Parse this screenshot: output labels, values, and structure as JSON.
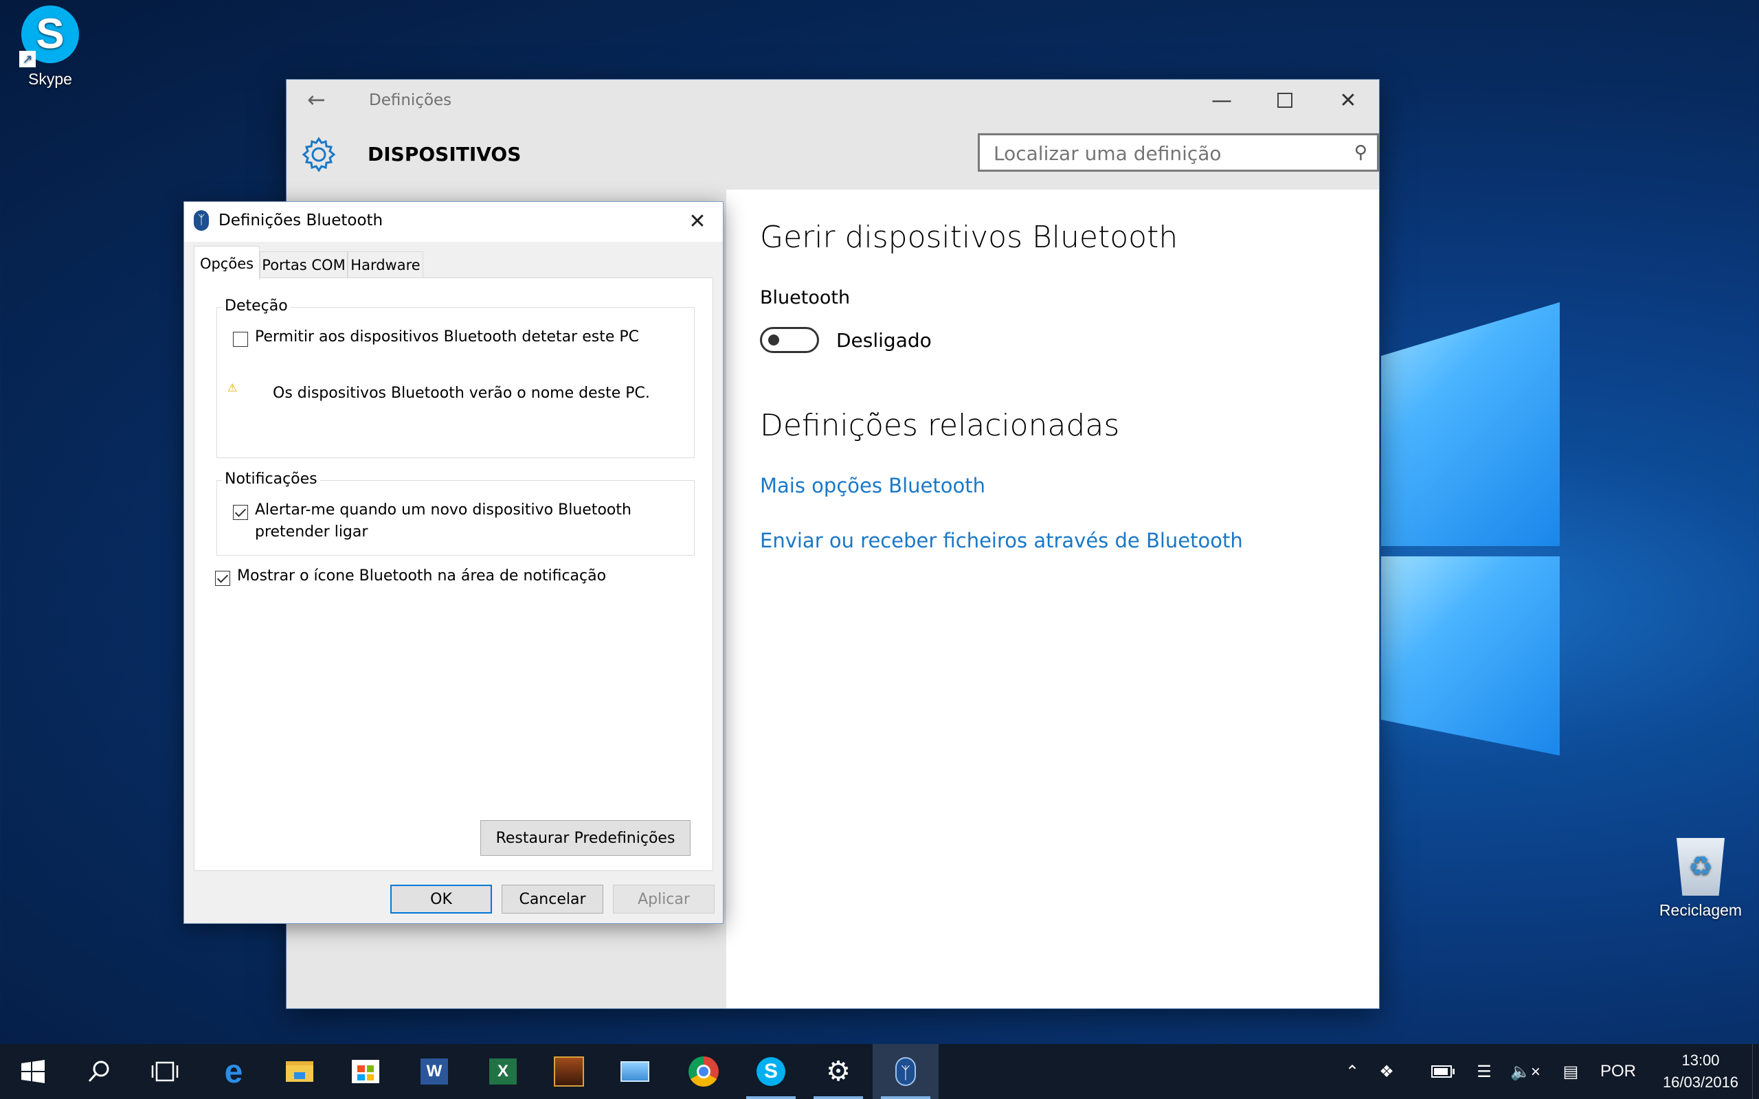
{
  "desktop": {
    "skype_label": "Skype",
    "recycle_label": "Reciclagem"
  },
  "settings": {
    "title": "Definições",
    "section": "DISPOSITIVOS",
    "search_placeholder": "Localizar uma definição",
    "heading": "Gerir dispositivos Bluetooth",
    "bluetooth_label": "Bluetooth",
    "toggle_state": "Desligado",
    "related_heading": "Definições relacionadas",
    "link_more": "Mais opções Bluetooth",
    "link_send": "Enviar ou receber ficheiros através de Bluetooth"
  },
  "dialog": {
    "title": "Definições Bluetooth",
    "tabs": [
      "Opções",
      "Portas COM",
      "Hardware"
    ],
    "group_detection": "Deteção",
    "allow_detect": "Permitir aos dispositivos Bluetooth detetar este PC",
    "warning": "Os dispositivos Bluetooth verão o nome deste PC.",
    "group_notifications": "Notificações",
    "alert_line1": "Alertar-me quando um novo dispositivo Bluetooth",
    "alert_line2": "pretender ligar",
    "show_icon": "Mostrar o ícone Bluetooth na área de notificação",
    "restore": "Restaurar Predefinições",
    "ok": "OK",
    "cancel": "Cancelar",
    "apply": "Aplicar"
  },
  "taskbar": {
    "lang": "POR",
    "time": "13:00",
    "date": "16/03/2016",
    "pinned": [
      "start-icon",
      "search-icon",
      "task-view-icon",
      "edge-icon",
      "file-explorer-icon",
      "store-icon",
      "word-icon",
      "excel-icon",
      "game-icon",
      "control-panel-icon",
      "chrome-icon",
      "skype-icon",
      "settings-icon",
      "bluetooth-icon"
    ]
  },
  "colors": {
    "accent": "#0078d7",
    "link": "#1a78c8",
    "taskbar": "#101a28"
  }
}
